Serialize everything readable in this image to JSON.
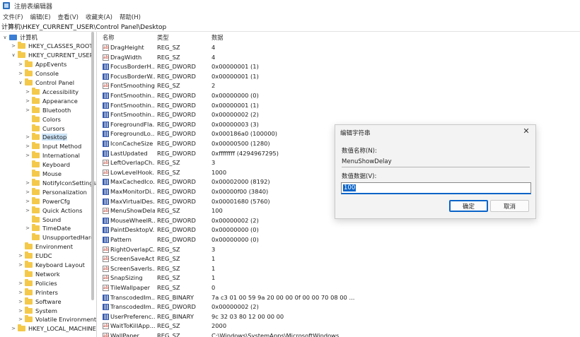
{
  "window": {
    "title": "注册表编辑器"
  },
  "menu": [
    "文件(F)",
    "编辑(E)",
    "查看(V)",
    "收藏夹(A)",
    "帮助(H)"
  ],
  "address": "计算机\\HKEY_CURRENT_USER\\Control Panel\\Desktop",
  "tree": [
    {
      "label": "计算机",
      "level": 0,
      "chev": "∨",
      "icon": "pc"
    },
    {
      "label": "HKEY_CLASSES_ROOT",
      "level": 1,
      "chev": ">",
      "icon": "folder"
    },
    {
      "label": "HKEY_CURRENT_USER",
      "level": 1,
      "chev": "∨",
      "icon": "folder"
    },
    {
      "label": "AppEvents",
      "level": 2,
      "chev": ">",
      "icon": "folder"
    },
    {
      "label": "Console",
      "level": 2,
      "chev": ">",
      "icon": "folder"
    },
    {
      "label": "Control Panel",
      "level": 2,
      "chev": "∨",
      "icon": "folder"
    },
    {
      "label": "Accessibility",
      "level": 3,
      "chev": ">",
      "icon": "folder"
    },
    {
      "label": "Appearance",
      "level": 3,
      "chev": ">",
      "icon": "folder"
    },
    {
      "label": "Bluetooth",
      "level": 3,
      "chev": ">",
      "icon": "folder"
    },
    {
      "label": "Colors",
      "level": 3,
      "chev": "",
      "icon": "folder"
    },
    {
      "label": "Cursors",
      "level": 3,
      "chev": "",
      "icon": "folder"
    },
    {
      "label": "Desktop",
      "level": 3,
      "chev": ">",
      "icon": "folder",
      "selected": true
    },
    {
      "label": "Input Method",
      "level": 3,
      "chev": ">",
      "icon": "folder"
    },
    {
      "label": "International",
      "level": 3,
      "chev": ">",
      "icon": "folder"
    },
    {
      "label": "Keyboard",
      "level": 3,
      "chev": "",
      "icon": "folder"
    },
    {
      "label": "Mouse",
      "level": 3,
      "chev": "",
      "icon": "folder"
    },
    {
      "label": "NotifyIconSettings",
      "level": 3,
      "chev": ">",
      "icon": "folder"
    },
    {
      "label": "Personalization",
      "level": 3,
      "chev": ">",
      "icon": "folder"
    },
    {
      "label": "PowerCfg",
      "level": 3,
      "chev": ">",
      "icon": "folder"
    },
    {
      "label": "Quick Actions",
      "level": 3,
      "chev": ">",
      "icon": "folder"
    },
    {
      "label": "Sound",
      "level": 3,
      "chev": "",
      "icon": "folder"
    },
    {
      "label": "TimeDate",
      "level": 3,
      "chev": ">",
      "icon": "folder"
    },
    {
      "label": "UnsupportedHard",
      "level": 3,
      "chev": "",
      "icon": "folder"
    },
    {
      "label": "Environment",
      "level": 2,
      "chev": "",
      "icon": "folder"
    },
    {
      "label": "EUDC",
      "level": 2,
      "chev": ">",
      "icon": "folder"
    },
    {
      "label": "Keyboard Layout",
      "level": 2,
      "chev": ">",
      "icon": "folder"
    },
    {
      "label": "Network",
      "level": 2,
      "chev": "",
      "icon": "folder"
    },
    {
      "label": "Policies",
      "level": 2,
      "chev": ">",
      "icon": "folder"
    },
    {
      "label": "Printers",
      "level": 2,
      "chev": ">",
      "icon": "folder"
    },
    {
      "label": "Software",
      "level": 2,
      "chev": ">",
      "icon": "folder"
    },
    {
      "label": "System",
      "level": 2,
      "chev": ">",
      "icon": "folder"
    },
    {
      "label": "Volatile Environment",
      "level": 2,
      "chev": ">",
      "icon": "folder"
    },
    {
      "label": "HKEY_LOCAL_MACHINE",
      "level": 1,
      "chev": ">",
      "icon": "folder"
    }
  ],
  "list": {
    "headers": {
      "name": "名称",
      "type": "类型",
      "data": "数据"
    },
    "rows": [
      {
        "name": "DragHeight",
        "type": "REG_SZ",
        "data": "4"
      },
      {
        "name": "DragWidth",
        "type": "REG_SZ",
        "data": "4"
      },
      {
        "name": "FocusBorderH...",
        "type": "REG_DWORD",
        "data": "0x00000001 (1)"
      },
      {
        "name": "FocusBorderW...",
        "type": "REG_DWORD",
        "data": "0x00000001 (1)"
      },
      {
        "name": "FontSmoothing",
        "type": "REG_SZ",
        "data": "2"
      },
      {
        "name": "FontSmoothin...",
        "type": "REG_DWORD",
        "data": "0x00000000 (0)"
      },
      {
        "name": "FontSmoothin...",
        "type": "REG_DWORD",
        "data": "0x00000001 (1)"
      },
      {
        "name": "FontSmoothin...",
        "type": "REG_DWORD",
        "data": "0x00000002 (2)"
      },
      {
        "name": "ForegroundFla...",
        "type": "REG_DWORD",
        "data": "0x00000003 (3)"
      },
      {
        "name": "ForegroundLo...",
        "type": "REG_DWORD",
        "data": "0x000186a0 (100000)"
      },
      {
        "name": "IconCacheSize",
        "type": "REG_DWORD",
        "data": "0x00000500 (1280)"
      },
      {
        "name": "LastUpdated",
        "type": "REG_DWORD",
        "data": "0xffffffff (4294967295)"
      },
      {
        "name": "LeftOverlapCh...",
        "type": "REG_SZ",
        "data": "3"
      },
      {
        "name": "LowLevelHook...",
        "type": "REG_SZ",
        "data": "1000"
      },
      {
        "name": "MaxCachedIco...",
        "type": "REG_DWORD",
        "data": "0x00002000 (8192)"
      },
      {
        "name": "MaxMonitorDi...",
        "type": "REG_DWORD",
        "data": "0x00000f00 (3840)"
      },
      {
        "name": "MaxVirtualDes...",
        "type": "REG_DWORD",
        "data": "0x00001680 (5760)"
      },
      {
        "name": "MenuShowDelay",
        "type": "REG_SZ",
        "data": "100"
      },
      {
        "name": "MouseWheelR...",
        "type": "REG_DWORD",
        "data": "0x00000002 (2)"
      },
      {
        "name": "PaintDesktopV...",
        "type": "REG_DWORD",
        "data": "0x00000000 (0)"
      },
      {
        "name": "Pattern",
        "type": "REG_DWORD",
        "data": "0x00000000 (0)"
      },
      {
        "name": "RightOverlapC...",
        "type": "REG_SZ",
        "data": "3"
      },
      {
        "name": "ScreenSaveActi...",
        "type": "REG_SZ",
        "data": "1"
      },
      {
        "name": "ScreenSaverIs...",
        "type": "REG_SZ",
        "data": "1"
      },
      {
        "name": "SnapSizing",
        "type": "REG_SZ",
        "data": "1"
      },
      {
        "name": "TileWallpaper",
        "type": "REG_SZ",
        "data": "0"
      },
      {
        "name": "TranscodedIm...",
        "type": "REG_BINARY",
        "data": "7a c3 01 00 59 9a 20 00 00 0f 00 00 70 08 00 ..."
      },
      {
        "name": "TranscodedIm...",
        "type": "REG_DWORD",
        "data": "0x00000002 (2)"
      },
      {
        "name": "UserPreferenc...",
        "type": "REG_BINARY",
        "data": "9c 32 03 80 12 00 00 00"
      },
      {
        "name": "WaitToKillApp...",
        "type": "REG_SZ",
        "data": "2000"
      },
      {
        "name": "WallPaper",
        "type": "REG_SZ",
        "data": "C:\\Windows\\SystemApps\\MicrosoftWindows..."
      }
    ]
  },
  "dialog": {
    "title": "编辑字符串",
    "close": "✕",
    "name_label": "数值名称(N):",
    "name_value": "MenuShowDelay",
    "data_label": "数值数据(V):",
    "data_value": "100",
    "ok": "确定",
    "cancel": "取消"
  }
}
